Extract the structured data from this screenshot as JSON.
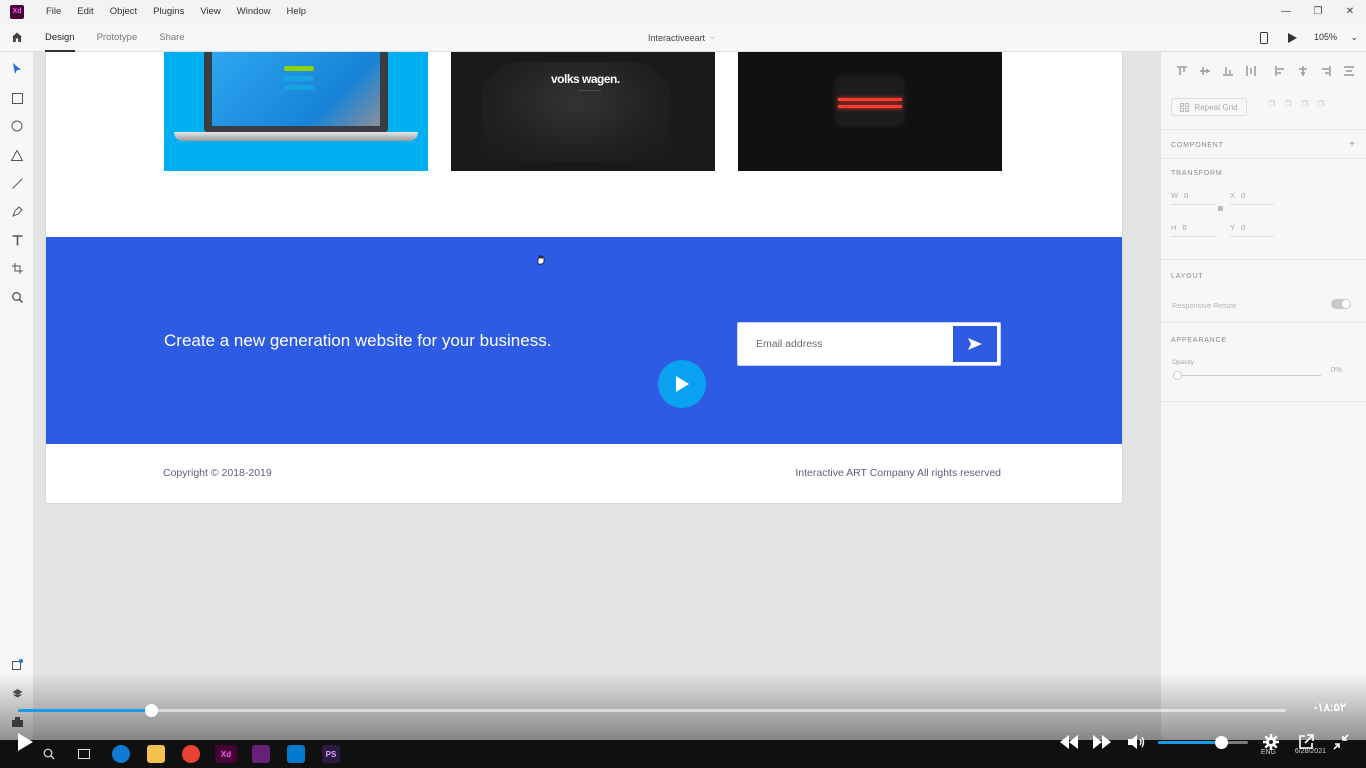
{
  "app": {
    "logo_text": "Xd",
    "menu": [
      "File",
      "Edit",
      "Object",
      "Plugins",
      "View",
      "Window",
      "Help"
    ],
    "window_controls": [
      "minimize-icon",
      "restore-icon",
      "close-icon"
    ]
  },
  "modebar": {
    "tabs": [
      {
        "label": "Design",
        "active": true
      },
      {
        "label": "Prototype",
        "active": false
      },
      {
        "label": "Share",
        "active": false
      }
    ],
    "document_title": "Interactiveeart",
    "zoom": "105%"
  },
  "tools": [
    "select-icon",
    "rectangle-icon",
    "ellipse-icon",
    "triangle-icon",
    "line-icon",
    "pen-icon",
    "text-icon",
    "artboard-icon",
    "zoom-icon"
  ],
  "canvas": {
    "thumbnails": [
      {
        "name": "laptop-mockup"
      },
      {
        "name": "volkswagen",
        "logo_text": "volks wagen."
      },
      {
        "name": "speaker-device"
      }
    ],
    "cta": {
      "headline": "Create a new generation website for your business.",
      "email_placeholder": "Email address",
      "band_color": "#2e5be3"
    },
    "footer": {
      "copyright": "Copyright © 2018-2019",
      "rights": "Interactive ART Company  All rights reserved"
    }
  },
  "panel": {
    "repeat_grid": "Repeat Grid",
    "component": "COMPONENT",
    "transform": "TRANSFORM",
    "w_label": "W",
    "w_value": "0",
    "x_label": "X",
    "x_value": "0",
    "h_label": "H",
    "h_value": "0",
    "y_label": "Y",
    "y_value": "0",
    "layout": "LAYOUT",
    "responsive_resize": "Responsive Resize",
    "appearance": "APPEARANCE",
    "opacity_label": "Opacity",
    "opacity_value": "0%"
  },
  "video": {
    "progress": 0.105,
    "time": "-۱۸:۵۲",
    "volume": 0.7,
    "accent": "#1a9be8"
  },
  "taskbar": {
    "lang": "ENG",
    "date": "6/28/2021"
  }
}
